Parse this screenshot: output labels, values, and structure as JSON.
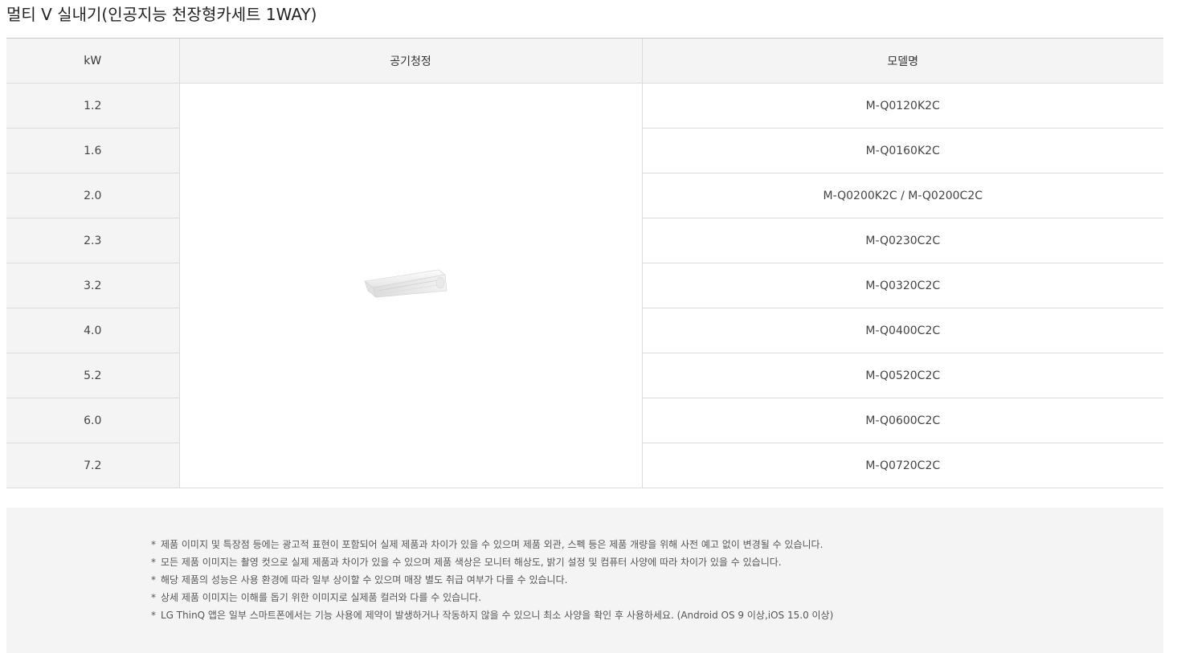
{
  "title": "멀티 V 실내기(인공지능 천장형카세트 1WAY)",
  "table": {
    "headers": [
      "kW",
      "공기청정",
      "모델명"
    ],
    "image_icon": "ceiling-cassette-1way-unit",
    "rows": [
      {
        "kw": "1.2",
        "model": "M-Q0120K2C"
      },
      {
        "kw": "1.6",
        "model": "M-Q0160K2C"
      },
      {
        "kw": "2.0",
        "model": "M-Q0200K2C / M-Q0200C2C"
      },
      {
        "kw": "2.3",
        "model": "M-Q0230C2C"
      },
      {
        "kw": "3.2",
        "model": "M-Q0320C2C"
      },
      {
        "kw": "4.0",
        "model": "M-Q0400C2C"
      },
      {
        "kw": "5.2",
        "model": "M-Q0520C2C"
      },
      {
        "kw": "6.0",
        "model": "M-Q0600C2C"
      },
      {
        "kw": "7.2",
        "model": "M-Q0720C2C"
      }
    ]
  },
  "notes": {
    "marker": "*",
    "items": [
      "제품 이미지 및 특장점 등에는 광고적 표현이 포함되어 실제 제품과 차이가 있을 수 있으며 제품 외관, 스펙 등은 제품 개량을 위해 사전 예고 없이 변경될 수 있습니다.",
      "모든 제품 이미지는 촬영 컷으로 실제 제품과 차이가 있을 수 있으며 제품 색상은 모니터 해상도, 밝기 설정 및 컴퓨터 사양에 따라 차이가 있을 수 있습니다.",
      "해당 제품의 성능은 사용 환경에 따라 일부 상이할 수 있으며 매장 별도 취급 여부가 다를 수 있습니다.",
      "상세 제품 이미지는 이해를 돕기 위한 이미지로 실제품 컬러와 다를 수 있습니다.",
      "LG ThinQ 앱은 일부 스마트폰에서는 기능 사용에 제약이 발생하거나 작동하지 않을 수 있으니 최소 사양을 확인 후 사용하세요. (Android OS 9 이상,iOS 15.0 이상)"
    ]
  }
}
